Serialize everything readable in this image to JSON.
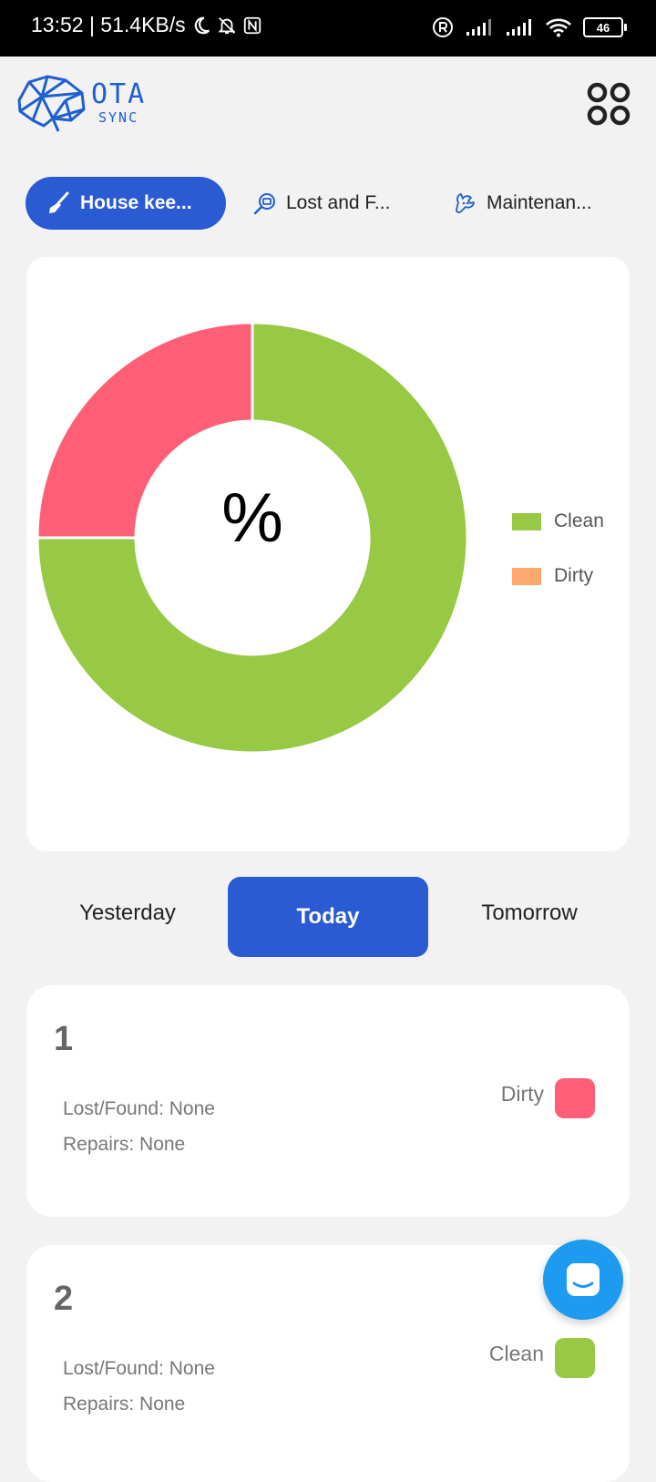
{
  "status_bar": {
    "time_speed": "13:52 | 51.4KB/s",
    "battery": "46"
  },
  "header": {
    "logo_main": "OTA",
    "logo_sub": "SYNC"
  },
  "tabs": [
    {
      "label": "House kee...",
      "icon": "broom-icon",
      "active": true
    },
    {
      "label": "Lost and F...",
      "icon": "lost-found-icon",
      "active": false
    },
    {
      "label": "Maintenan...",
      "icon": "maintenance-icon",
      "active": false
    }
  ],
  "chart_data": {
    "type": "pie",
    "variant": "donut",
    "center_label": "%",
    "slices": [
      {
        "label": "Clean",
        "value": 75,
        "color": "#97c944"
      },
      {
        "label": "Dirty",
        "value": 25,
        "color": "#fe5f76"
      }
    ],
    "legend": [
      {
        "label": "Clean",
        "color": "#97c944"
      },
      {
        "label": "Dirty",
        "color": "#ffa86e"
      }
    ],
    "legend_position": "right"
  },
  "day_tabs": [
    {
      "label": "Yesterday",
      "active": false
    },
    {
      "label": "Today",
      "active": true
    },
    {
      "label": "Tomorrow",
      "active": false
    }
  ],
  "rooms": [
    {
      "number": "1",
      "lost_found": "Lost/Found: None",
      "repairs": "Repairs: None",
      "status": "Dirty",
      "color": "#fe5f76"
    },
    {
      "number": "2",
      "lost_found": "Lost/Found: None",
      "repairs": "Repairs: None",
      "status": "Clean",
      "color": "#97c944"
    }
  ],
  "colors": {
    "accent": "#2a5bd3",
    "fab": "#1d9bf0"
  }
}
